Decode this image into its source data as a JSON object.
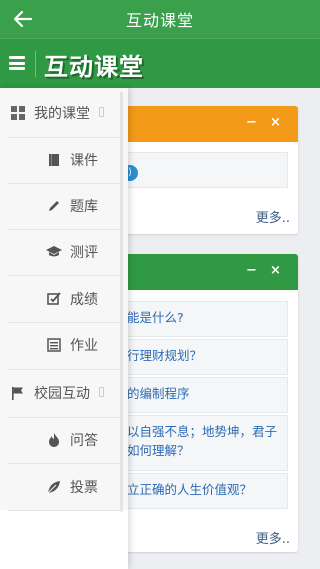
{
  "appbar": {
    "title": "互动课堂"
  },
  "brand": {
    "logo_text": "互动课堂"
  },
  "panels": {
    "orange": {
      "badge": "正)",
      "more": "更多.."
    },
    "green": {
      "questions": [
        "能是什么?",
        "行理财规划？",
        "的编制程序",
        "以自强不息；地势坤，君子",
        "如何理解？",
        "立正确的人生价值观？"
      ],
      "more": "更多.."
    },
    "header_controls": {
      "minimize": "−",
      "close": "×"
    }
  },
  "drawer": {
    "sections": [
      {
        "label": "我的课堂",
        "icon": "grid-icon",
        "items": [
          {
            "label": "课件",
            "icon": "book-icon"
          },
          {
            "label": "题库",
            "icon": "pencil-icon"
          },
          {
            "label": "测评",
            "icon": "graduation-cap-icon"
          },
          {
            "label": "成绩",
            "icon": "checklist-icon"
          },
          {
            "label": "作业",
            "icon": "list-icon"
          }
        ]
      },
      {
        "label": "校园互动",
        "icon": "flag-icon",
        "items": [
          {
            "label": "问答",
            "icon": "fire-icon"
          },
          {
            "label": "投票",
            "icon": "leaf-icon"
          }
        ]
      }
    ]
  },
  "colors": {
    "appbar": "#3aa04c",
    "brandbar": "#2f9a43",
    "orange_header": "#f39a18",
    "link_blue": "#2d6bb3"
  }
}
